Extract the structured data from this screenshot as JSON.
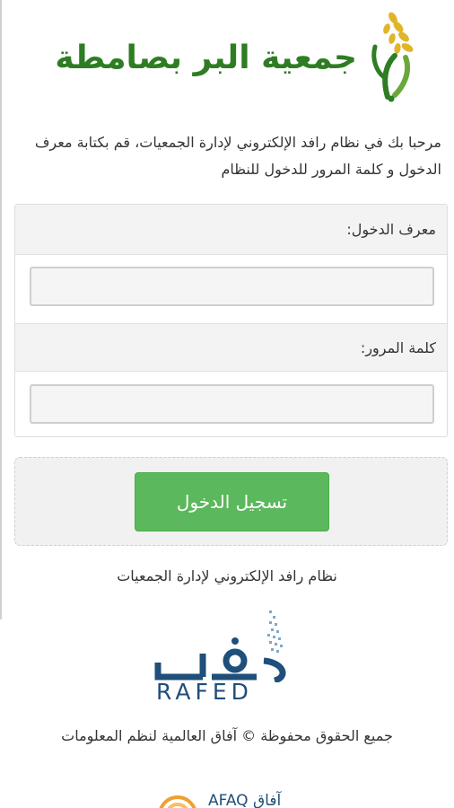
{
  "header": {
    "logo_text": "جمعية البر بصامطة"
  },
  "welcome_text": "مرحبا بك في نظام رافد الإلكتروني لإدارة الجمعيات، قم بكتابة معرف الدخول و كلمة المرور للدخول للنظام",
  "form": {
    "username_label": "معرف الدخول:",
    "username_value": "",
    "password_label": "كلمة المرور:",
    "password_value": "",
    "login_button": "تسجيل الدخول"
  },
  "footer": {
    "system_name": "نظام رافد الإلكتروني لإدارة الجمعيات",
    "rafed_logo_latin": "RAFED",
    "copyright": "جميع الحقوق محفوظة © آفاق العالمية لنظم المعلومات",
    "afaq_logo_text": "AFAQ آفاق"
  },
  "colors": {
    "brand_green": "#2e7d23",
    "button_green": "#5cb85c",
    "rafed_blue": "#1f4f7a",
    "wheat_gold": "#e0b52a"
  }
}
